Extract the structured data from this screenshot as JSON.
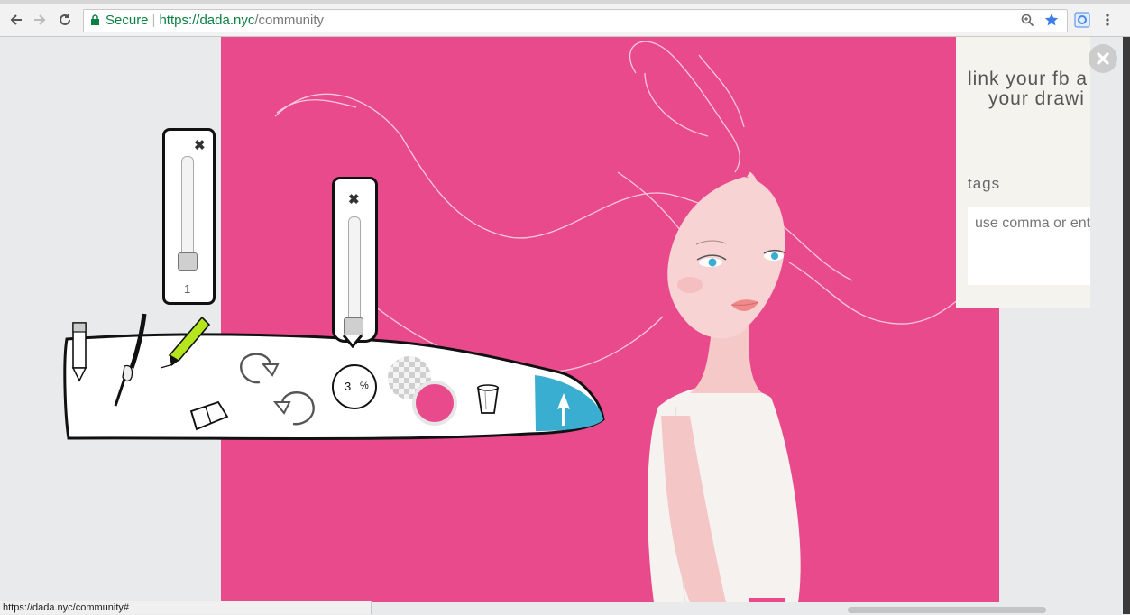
{
  "browser": {
    "secure_label": "Secure",
    "url_scheme_host": "https://dada.nyc",
    "url_path": "/community",
    "status_url": "https://dada.nyc/community#"
  },
  "side_panel": {
    "fb_line1": "link your fb a",
    "fb_line2": "your drawi",
    "tags_label": "tags",
    "tags_placeholder": "use comma or ent"
  },
  "tools": {
    "brush_size_value": "1",
    "opacity_value": "3",
    "opacity_unit": "%",
    "current_color": "#e94a8c",
    "brush_size_level": 0.05,
    "opacity_level": 0.03
  },
  "colors": {
    "canvas_bg": "#e94a8c",
    "accent_blue": "#3aaed1"
  }
}
